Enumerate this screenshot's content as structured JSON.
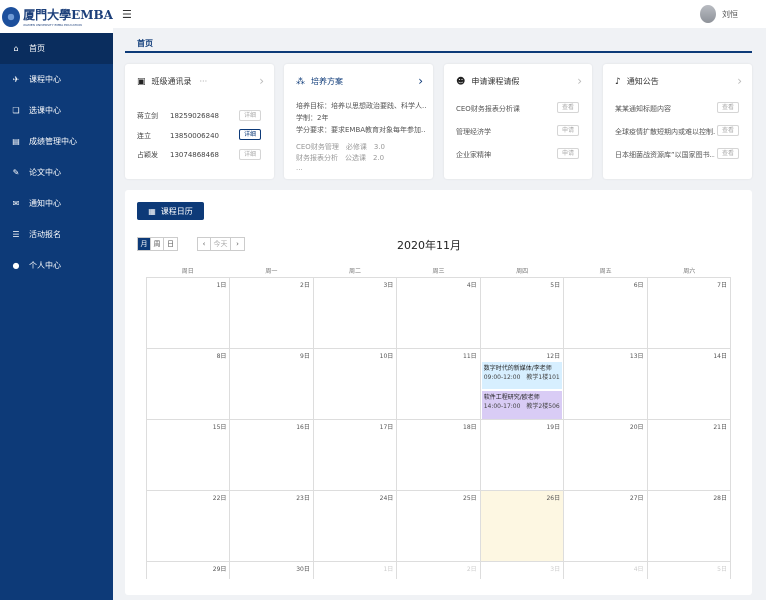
{
  "logo": {
    "main": "厦門大學EMBA",
    "sub": "XIAMEN UNIVERSITY EMBA EDUCATION"
  },
  "header": {
    "username": "刘恒"
  },
  "nav": [
    {
      "label": "首页",
      "icon": "home-icon",
      "glyph": "⌂"
    },
    {
      "label": "课程中心",
      "icon": "course-icon",
      "glyph": "✈"
    },
    {
      "label": "选课中心",
      "icon": "book-icon",
      "glyph": "❏"
    },
    {
      "label": "成绩管理中心",
      "icon": "file-icon",
      "glyph": "▤"
    },
    {
      "label": "论文中心",
      "icon": "paper-icon",
      "glyph": "✎"
    },
    {
      "label": "通知中心",
      "icon": "mail-icon",
      "glyph": "✉"
    },
    {
      "label": "活动报名",
      "icon": "list-icon",
      "glyph": "☰"
    },
    {
      "label": "个人中心",
      "icon": "user-icon",
      "glyph": "●"
    }
  ],
  "breadcrumb": "首页",
  "card1": {
    "title": "班级通讯录",
    "dots": "···",
    "rows": [
      {
        "name": "蒋立剑",
        "phone": "18259026848",
        "btn": "详细"
      },
      {
        "name": "连立",
        "phone": "13850006240",
        "btn": "详细"
      },
      {
        "name": "占颖发",
        "phone": "13074868468",
        "btn": "详细"
      }
    ]
  },
  "card2": {
    "title": "培养方案",
    "lines": [
      "培养目标：培养以思想政治要践、科学人...",
      "学制：2年",
      "学分要求：要求EMBA教育对象每年参加..."
    ],
    "grey": [
      "CEO财务管理　必修课　3.0",
      "财务报表分析　公选课　2.0",
      "..."
    ]
  },
  "card3": {
    "title": "申请课程请假",
    "rows": [
      {
        "text": "CEO财务报表分析课",
        "btn": "查看"
      },
      {
        "text": "管理经济学",
        "btn": "申请"
      },
      {
        "text": "企业家精神",
        "btn": "申请"
      }
    ]
  },
  "card4": {
    "title": "通知公告",
    "rows": [
      {
        "text": "某某通知标题内容",
        "btn": "查看"
      },
      {
        "text": "全球疫情扩散短期内或难以控制...",
        "btn": "查看"
      },
      {
        "text": "日本细菌战资源库”以国家图书...",
        "btn": "查看"
      }
    ]
  },
  "calendar": {
    "button": "课程日历",
    "views": [
      "月",
      "周",
      "日"
    ],
    "nav": [
      "‹",
      "今天",
      "›"
    ],
    "title": "2020年11月",
    "dow": [
      "周日",
      "周一",
      "周二",
      "周三",
      "周四",
      "周五",
      "周六"
    ],
    "weeks": [
      [
        "1日",
        "2日",
        "3日",
        "4日",
        "5日",
        "6日",
        "7日"
      ],
      [
        "8日",
        "9日",
        "10日",
        "11日",
        "12日",
        "13日",
        "14日"
      ],
      [
        "15日",
        "16日",
        "17日",
        "18日",
        "19日",
        "20日",
        "21日"
      ],
      [
        "22日",
        "23日",
        "24日",
        "25日",
        "26日",
        "27日",
        "28日"
      ],
      [
        "29日",
        "30日",
        "1日",
        "2日",
        "3日",
        "4日",
        "5日"
      ]
    ],
    "events": [
      {
        "title": "数字时代的新媒体/李老师",
        "time": "09:00-12:00　教学1楼101"
      },
      {
        "title": "软件工程研究/欧老师",
        "time": "14:00-17:00　教学2楼506"
      }
    ]
  }
}
